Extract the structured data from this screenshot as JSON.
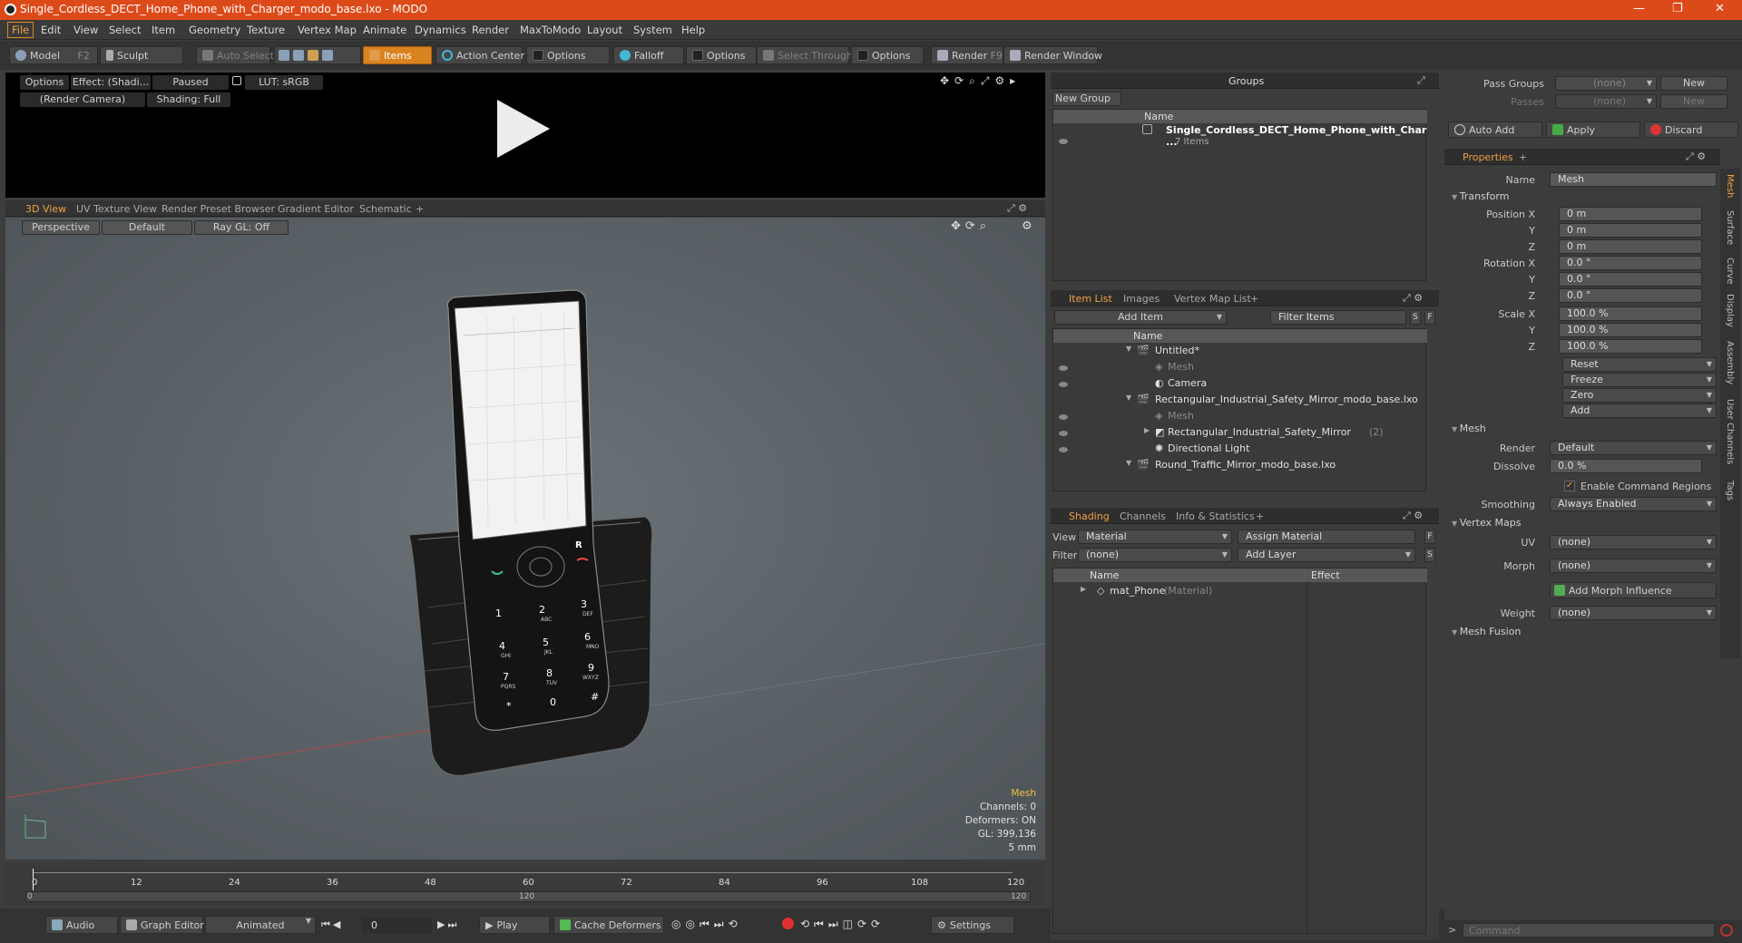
{
  "window": {
    "title": "Single_Cordless_DECT_Home_Phone_with_Charger_modo_base.lxo - MODO",
    "controls": [
      "—",
      "❐",
      "✕"
    ]
  },
  "menu": [
    "File",
    "Edit",
    "View",
    "Select",
    "Item",
    "Geometry",
    "Texture",
    "Vertex Map",
    "Animate",
    "Dynamics",
    "Render",
    "MaxToModo",
    "Layout",
    "System",
    "Help"
  ],
  "toolbar": {
    "model": "Model",
    "model_key": "F2",
    "sculpt": "Sculpt",
    "auto_select": "Auto Select",
    "items": "Items",
    "action_center": "Action Center",
    "options1": "Options",
    "falloff": "Falloff",
    "options2": "Options",
    "select_through": "Select Through",
    "options3": "Options",
    "render": "Render",
    "render_key": "F9",
    "render_window": "Render Window"
  },
  "preview": {
    "options": "Options",
    "effect": "Effect: (Shadi...",
    "paused": "Paused",
    "lut": "LUT: sRGB",
    "camera": "(Render Camera)",
    "shading": "Shading: Full"
  },
  "viewport": {
    "tabs": [
      "3D View",
      "UV Texture View",
      "Render Preset Browser",
      "Gradient Editor",
      "Schematic",
      "+"
    ],
    "perspective": "Perspective",
    "default": "Default",
    "raygl": "Ray GL: Off",
    "info": {
      "type": "Mesh",
      "channels": "Channels: 0",
      "deformers": "Deformers: ON",
      "gl": "GL: 399,136",
      "scale": "5 mm"
    }
  },
  "phone_keys": [
    "1",
    "2",
    "3",
    "4",
    "5",
    "6",
    "7",
    "8",
    "9",
    "*",
    "0",
    "#"
  ],
  "phone_subkeys": [
    "ABC",
    "DEF",
    "GHI",
    "JKL",
    "MNO",
    "PQRS",
    "TUV",
    "WXYZ"
  ],
  "phone_top": "R",
  "timeline": {
    "ticks_top": [
      "0",
      "12",
      "24",
      "36",
      "48",
      "60",
      "72",
      "84",
      "96",
      "108",
      "120"
    ],
    "ticks_bottom": [
      "0",
      "120",
      "120"
    ]
  },
  "bottombar": {
    "audio": "Audio",
    "graph_editor": "Graph Editor",
    "animated": "Animated",
    "frame": "0",
    "play": "Play",
    "cache": "Cache Deformers",
    "settings": "Settings"
  },
  "groups": {
    "title": "Groups",
    "new_group": "New Group",
    "col_name": "Name",
    "item": "Single_Cordless_DECT_Home_Phone_with_Char ...",
    "item_sub": "7 Items"
  },
  "itemlist": {
    "tabs": [
      "Item List",
      "Images",
      "Vertex Map List",
      "+"
    ],
    "add_item": "Add Item",
    "filter": "Filter Items",
    "col_name": "Name",
    "rows": [
      {
        "label": "Untitled*",
        "indent": 0,
        "dim": false,
        "expand": "▼"
      },
      {
        "label": "Mesh",
        "indent": 1,
        "dim": true,
        "expand": ""
      },
      {
        "label": "Camera",
        "indent": 1,
        "dim": false,
        "expand": ""
      },
      {
        "label": "Rectangular_Industrial_Safety_Mirror_modo_base.lxo",
        "indent": 0,
        "dim": false,
        "expand": "▼"
      },
      {
        "label": "Mesh",
        "indent": 1,
        "dim": true,
        "expand": ""
      },
      {
        "label": "Rectangular_Industrial_Safety_Mirror",
        "indent": 1,
        "dim": false,
        "expand": "▶",
        "suffix": "(2)"
      },
      {
        "label": "Directional Light",
        "indent": 1,
        "dim": false,
        "expand": ""
      },
      {
        "label": "Round_Traffic_Mirror_modo_base.lxo",
        "indent": 0,
        "dim": false,
        "expand": "▼"
      }
    ]
  },
  "shading": {
    "tabs": [
      "Shading",
      "Channels",
      "Info & Statistics",
      "+"
    ],
    "view_label": "View",
    "view_value": "Material",
    "assign": "Assign Material",
    "filter_label": "Filter",
    "filter_value": "(none)",
    "add_layer": "Add Layer",
    "col_name": "Name",
    "col_effect": "Effect",
    "row": "mat_Phone",
    "row_type": "(Material)"
  },
  "passes": {
    "pass_groups": "Pass Groups",
    "passes": "Passes",
    "none1": "(none)",
    "none2": "(none)",
    "new1": "New",
    "new2": "New",
    "auto_add": "Auto Add",
    "apply": "Apply",
    "discard": "Discard"
  },
  "properties": {
    "tab": "Properties",
    "name_label": "Name",
    "name_value": "Mesh",
    "transform": "Transform",
    "pos_label": "Position X",
    "rot_label": "Rotation X",
    "scale_label": "Scale X",
    "y": "Y",
    "z": "Z",
    "pos": [
      "0 m",
      "0 m",
      "0 m"
    ],
    "rot": [
      "0.0 °",
      "0.0 °",
      "0.0 °"
    ],
    "scale": [
      "100.0 %",
      "100.0 %",
      "100.0 %"
    ],
    "reset": "Reset",
    "freeze": "Freeze",
    "zero": "Zero",
    "add": "Add",
    "mesh": "Mesh",
    "render_label": "Render",
    "render_value": "Default",
    "dissolve_label": "Dissolve",
    "dissolve_value": "0.0 %",
    "enable_cmd": "Enable Command Regions",
    "smoothing_label": "Smoothing",
    "smoothing_value": "Always Enabled",
    "vertex_maps": "Vertex Maps",
    "uv_label": "UV",
    "uv_value": "(none)",
    "morph_label": "Morph",
    "morph_value": "(none)",
    "add_morph": "Add Morph Influence",
    "weight_label": "Weight",
    "weight_value": "(none)",
    "mesh_fusion": "Mesh Fusion",
    "side_tabs": [
      "Mesh",
      "Surface",
      "Curve",
      "Display",
      "Assembly",
      "User Channels",
      "Tags"
    ]
  },
  "command": {
    "placeholder": "Command"
  },
  "colors": {
    "accent": "#f0a040",
    "title": "#dd4a19"
  }
}
